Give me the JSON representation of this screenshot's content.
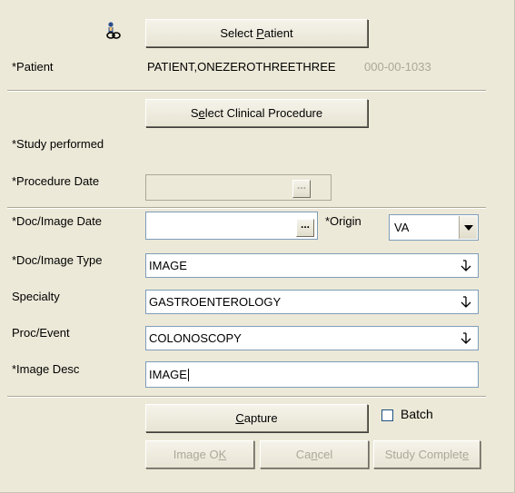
{
  "patient_section": {
    "icon": "patient-link-icon",
    "select_patient_label_pre": "Select ",
    "select_patient_label_key": "P",
    "select_patient_label_post": "atient",
    "patient_label": "*Patient",
    "patient_name": "PATIENT,ONEZEROTHREETHREE",
    "patient_ssn": "000-00-1033"
  },
  "procedure_section": {
    "select_proc_pre": "S",
    "select_proc_key": "e",
    "select_proc_post": "lect Clinical Procedure",
    "study_performed_label": "*Study performed",
    "procedure_date_label": "*Procedure Date",
    "procedure_date_value": "",
    "ellipsis": "..."
  },
  "doc_section": {
    "doc_date_label": "*Doc/Image Date",
    "doc_date_value": "",
    "ellipsis": "...",
    "origin_label": "*Origin",
    "origin_value": "VA",
    "doc_type_label": "*Doc/Image Type",
    "doc_type_value": "IMAGE",
    "specialty_label": "Specialty",
    "specialty_value": "GASTROENTEROLOGY",
    "proc_event_label": "Proc/Event",
    "proc_event_value": "COLONOSCOPY",
    "image_desc_label": "*Image Desc",
    "image_desc_value": "IMAGE"
  },
  "actions": {
    "capture_key": "C",
    "capture_post": "apture",
    "batch_label": "Batch",
    "batch_checked": false,
    "image_ok_pre": "Image O",
    "image_ok_key": "K",
    "cancel_pre": "Ca",
    "cancel_key": "n",
    "cancel_post": "cel",
    "study_complete_pre": "Study Complet",
    "study_complete_key": "e"
  }
}
